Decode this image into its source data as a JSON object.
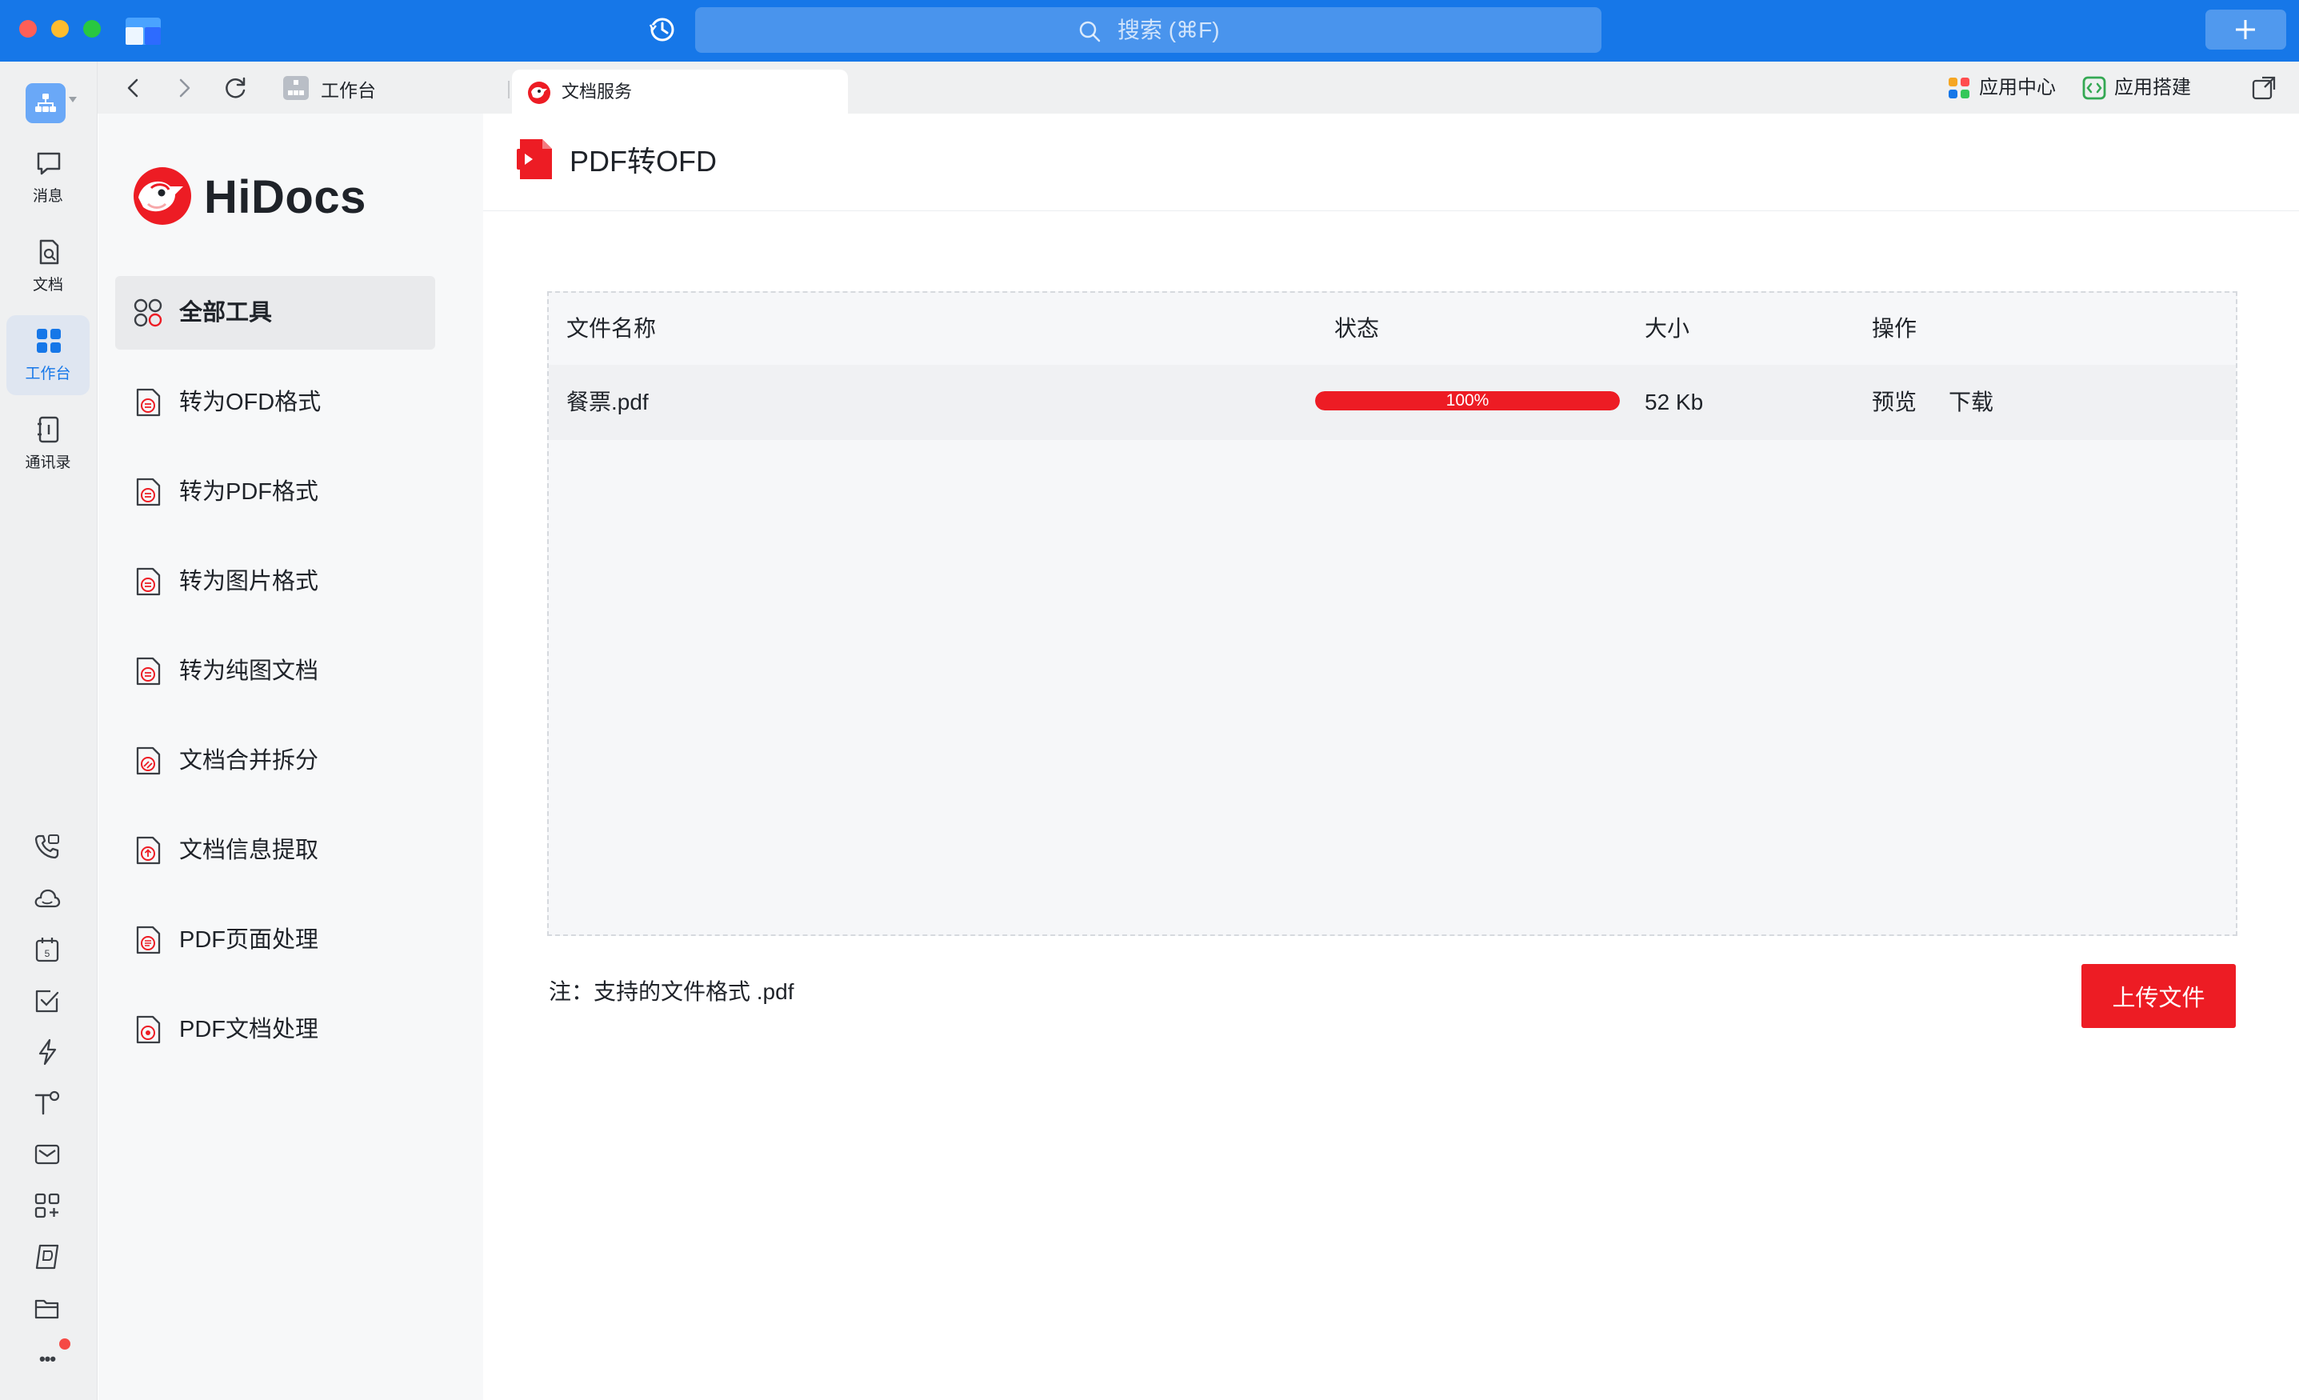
{
  "titlebar": {
    "search_placeholder": "搜索 (⌘F)"
  },
  "rail": {
    "items": [
      {
        "label": "消息",
        "icon": "message-icon"
      },
      {
        "label": "文档",
        "icon": "document-icon"
      },
      {
        "label": "工作台",
        "icon": "workbench-icon"
      },
      {
        "label": "通讯录",
        "icon": "contacts-icon"
      }
    ],
    "mini_icons": [
      "phone-icon",
      "cloud-icon",
      "calendar-icon",
      "task-check-icon",
      "flash-icon",
      "text-format-icon",
      "mail-icon",
      "apps-add-icon",
      "docs-icon",
      "folder-icon",
      "more-icon"
    ],
    "calendar_day": "5",
    "more_glyph": "•••"
  },
  "tabs": {
    "breadcrumb": "工作台",
    "active_tab": "文档服务",
    "app_center": "应用中心",
    "app_builder": "应用搭建"
  },
  "sidebar": {
    "brand": "HiDocs",
    "tools": [
      {
        "label": "全部工具",
        "icon": "grid-tools-icon",
        "selected": true
      },
      {
        "label": "转为OFD格式",
        "icon": "doc-convert-icon",
        "selected": false
      },
      {
        "label": "转为PDF格式",
        "icon": "doc-convert-icon",
        "selected": false
      },
      {
        "label": "转为图片格式",
        "icon": "doc-convert-icon",
        "selected": false
      },
      {
        "label": "转为纯图文档",
        "icon": "doc-convert-icon",
        "selected": false
      },
      {
        "label": "文档合并拆分",
        "icon": "doc-merge-icon",
        "selected": false
      },
      {
        "label": "文档信息提取",
        "icon": "doc-extract-icon",
        "selected": false
      },
      {
        "label": "PDF页面处理",
        "icon": "doc-page-icon",
        "selected": false
      },
      {
        "label": "PDF文档处理",
        "icon": "doc-process-icon",
        "selected": false
      }
    ]
  },
  "main": {
    "title": "PDF转OFD",
    "table": {
      "headers": {
        "name": "文件名称",
        "status": "状态",
        "size": "大小",
        "actions": "操作"
      },
      "rows": [
        {
          "name": "餐票.pdf",
          "progress": 1.0,
          "progress_label": "100%",
          "size": "52 Kb",
          "preview": "预览",
          "download": "下载"
        }
      ]
    },
    "note": "注：支持的文件格式 .pdf",
    "upload_label": "上传文件"
  },
  "colors": {
    "titlebar": "#1677e8",
    "brand_red": "#ed1c24",
    "active_blue": "#1677e8"
  }
}
